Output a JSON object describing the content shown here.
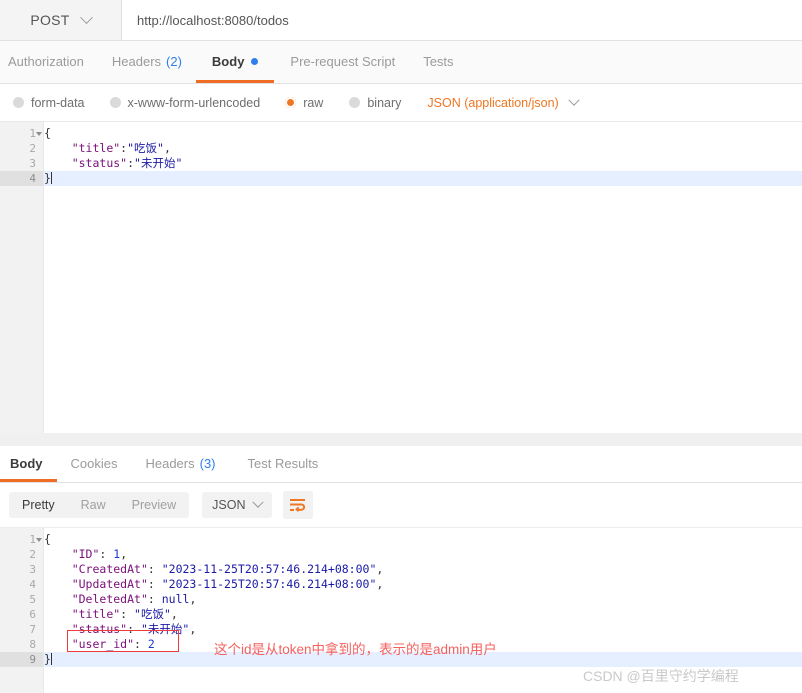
{
  "request_bar": {
    "method": "POST",
    "method_icon": "chevron-down-icon",
    "url": "http://localhost:8080/todos"
  },
  "request_tabs": [
    {
      "label": "Authorization",
      "active": false,
      "count": "",
      "dot": false
    },
    {
      "label": "Headers",
      "active": false,
      "count": "(2)",
      "dot": false
    },
    {
      "label": "Body",
      "active": true,
      "count": "",
      "dot": true
    },
    {
      "label": "Pre-request Script",
      "active": false,
      "count": "",
      "dot": false
    },
    {
      "label": "Tests",
      "active": false,
      "count": "",
      "dot": false
    }
  ],
  "body_type": {
    "options": [
      {
        "label": "form-data",
        "selected": false
      },
      {
        "label": "x-www-form-urlencoded",
        "selected": false
      },
      {
        "label": "raw",
        "selected": true
      },
      {
        "label": "binary",
        "selected": false
      }
    ],
    "content_type": "JSON (application/json)",
    "content_type_icon": "chevron-down-icon"
  },
  "request_body": {
    "lines": [
      {
        "no": "1",
        "fold": true,
        "highlight": false,
        "tokens": [
          {
            "t": "{",
            "c": "p"
          }
        ]
      },
      {
        "no": "2",
        "fold": false,
        "highlight": false,
        "tokens": [
          {
            "t": "    ",
            "c": "p"
          },
          {
            "t": "\"title\"",
            "c": "k"
          },
          {
            "t": ":",
            "c": "p"
          },
          {
            "t": "\"吃饭\"",
            "c": "s"
          },
          {
            "t": ",",
            "c": "p"
          }
        ]
      },
      {
        "no": "3",
        "fold": false,
        "highlight": false,
        "tokens": [
          {
            "t": "    ",
            "c": "p"
          },
          {
            "t": "\"status\"",
            "c": "k"
          },
          {
            "t": ":",
            "c": "p"
          },
          {
            "t": "\"未开始\"",
            "c": "s"
          }
        ]
      },
      {
        "no": "4",
        "fold": false,
        "highlight": true,
        "caret": true,
        "tokens": [
          {
            "t": "}",
            "c": "p"
          }
        ]
      }
    ]
  },
  "response_tabs": [
    {
      "label": "Body",
      "active": true,
      "count": ""
    },
    {
      "label": "Cookies",
      "active": false,
      "count": ""
    },
    {
      "label": "Headers",
      "active": false,
      "count": "(3)"
    },
    {
      "label": "Test Results",
      "active": false,
      "count": ""
    }
  ],
  "response_toolbar": {
    "view_modes": [
      {
        "label": "Pretty",
        "active": true
      },
      {
        "label": "Raw",
        "active": false
      },
      {
        "label": "Preview",
        "active": false
      }
    ],
    "format": "JSON",
    "format_icon": "chevron-down-icon",
    "wrap_icon": "word-wrap-icon"
  },
  "response_body": {
    "lines": [
      {
        "no": "1",
        "fold": true,
        "highlight": false,
        "tokens": [
          {
            "t": "{",
            "c": "p"
          }
        ]
      },
      {
        "no": "2",
        "fold": false,
        "highlight": false,
        "tokens": [
          {
            "t": "    ",
            "c": "p"
          },
          {
            "t": "\"ID\"",
            "c": "k"
          },
          {
            "t": ": ",
            "c": "p"
          },
          {
            "t": "1",
            "c": "n"
          },
          {
            "t": ",",
            "c": "p"
          }
        ]
      },
      {
        "no": "3",
        "fold": false,
        "highlight": false,
        "tokens": [
          {
            "t": "    ",
            "c": "p"
          },
          {
            "t": "\"CreatedAt\"",
            "c": "k"
          },
          {
            "t": ": ",
            "c": "p"
          },
          {
            "t": "\"2023-11-25T20:57:46.214+08:00\"",
            "c": "s"
          },
          {
            "t": ",",
            "c": "p"
          }
        ]
      },
      {
        "no": "4",
        "fold": false,
        "highlight": false,
        "tokens": [
          {
            "t": "    ",
            "c": "p"
          },
          {
            "t": "\"UpdatedAt\"",
            "c": "k"
          },
          {
            "t": ": ",
            "c": "p"
          },
          {
            "t": "\"2023-11-25T20:57:46.214+08:00\"",
            "c": "s"
          },
          {
            "t": ",",
            "c": "p"
          }
        ]
      },
      {
        "no": "5",
        "fold": false,
        "highlight": false,
        "tokens": [
          {
            "t": "    ",
            "c": "p"
          },
          {
            "t": "\"DeletedAt\"",
            "c": "k"
          },
          {
            "t": ": ",
            "c": "p"
          },
          {
            "t": "null",
            "c": "nul"
          },
          {
            "t": ",",
            "c": "p"
          }
        ]
      },
      {
        "no": "6",
        "fold": false,
        "highlight": false,
        "tokens": [
          {
            "t": "    ",
            "c": "p"
          },
          {
            "t": "\"title\"",
            "c": "k"
          },
          {
            "t": ": ",
            "c": "p"
          },
          {
            "t": "\"吃饭\"",
            "c": "s"
          },
          {
            "t": ",",
            "c": "p"
          }
        ]
      },
      {
        "no": "7",
        "fold": false,
        "highlight": false,
        "tokens": [
          {
            "t": "    ",
            "c": "p"
          },
          {
            "t": "\"status\"",
            "c": "k"
          },
          {
            "t": ": ",
            "c": "p"
          },
          {
            "t": "\"未开始\"",
            "c": "s"
          },
          {
            "t": ",",
            "c": "p"
          }
        ]
      },
      {
        "no": "8",
        "fold": false,
        "highlight": false,
        "tokens": [
          {
            "t": "    ",
            "c": "p"
          },
          {
            "t": "\"user_id\"",
            "c": "k"
          },
          {
            "t": ": ",
            "c": "p"
          },
          {
            "t": "2",
            "c": "n"
          }
        ]
      },
      {
        "no": "9",
        "fold": false,
        "highlight": true,
        "caret": true,
        "tokens": [
          {
            "t": "}",
            "c": "p"
          }
        ]
      }
    ]
  },
  "annotation": {
    "text": "这个id是从token中拿到的，表示的是admin用户",
    "color": "#f4615f"
  },
  "watermark": {
    "text": "CSDN @百里守约学编程"
  }
}
